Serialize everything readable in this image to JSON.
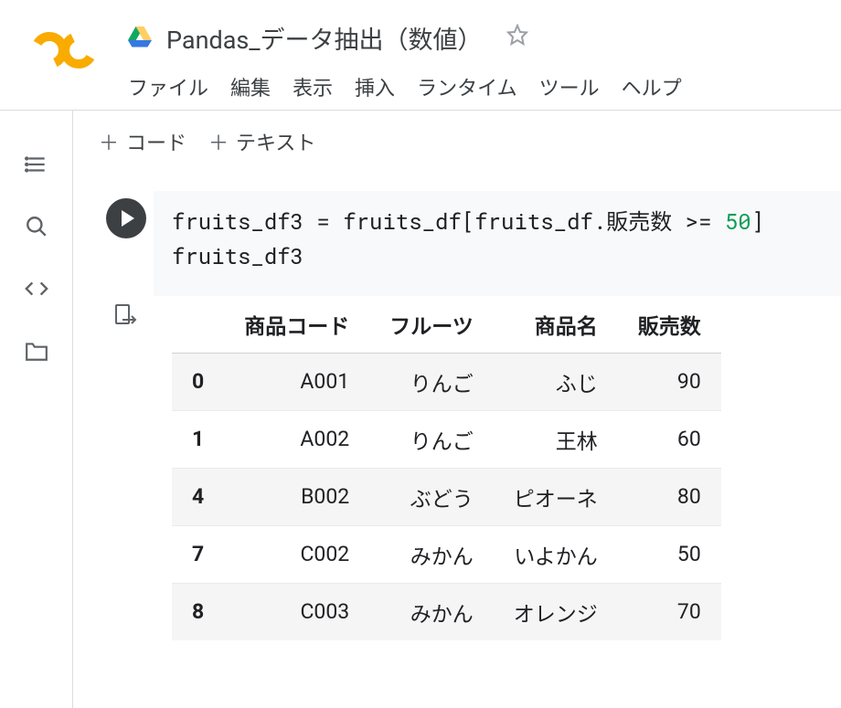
{
  "header": {
    "title": "Pandas_データ抽出（数値）"
  },
  "menu": {
    "file": "ファイル",
    "edit": "編集",
    "view": "表示",
    "insert": "挿入",
    "runtime": "ランタイム",
    "tools": "ツール",
    "help": "ヘルプ"
  },
  "toolbar": {
    "code": "コード",
    "text": "テキスト"
  },
  "code": {
    "line1_pre": "fruits_df3 = fruits_df[fruits_df.販売数 >= ",
    "line1_num": "50",
    "line1_post": "]",
    "line2": "fruits_df3"
  },
  "table": {
    "columns": [
      "商品コード",
      "フルーツ",
      "商品名",
      "販売数"
    ],
    "rows": [
      {
        "index": "0",
        "cells": [
          "A001",
          "りんご",
          "ふじ",
          "90"
        ]
      },
      {
        "index": "1",
        "cells": [
          "A002",
          "りんご",
          "王林",
          "60"
        ]
      },
      {
        "index": "4",
        "cells": [
          "B002",
          "ぶどう",
          "ピオーネ",
          "80"
        ]
      },
      {
        "index": "7",
        "cells": [
          "C002",
          "みかん",
          "いよかん",
          "50"
        ]
      },
      {
        "index": "8",
        "cells": [
          "C003",
          "みかん",
          "オレンジ",
          "70"
        ]
      }
    ]
  }
}
